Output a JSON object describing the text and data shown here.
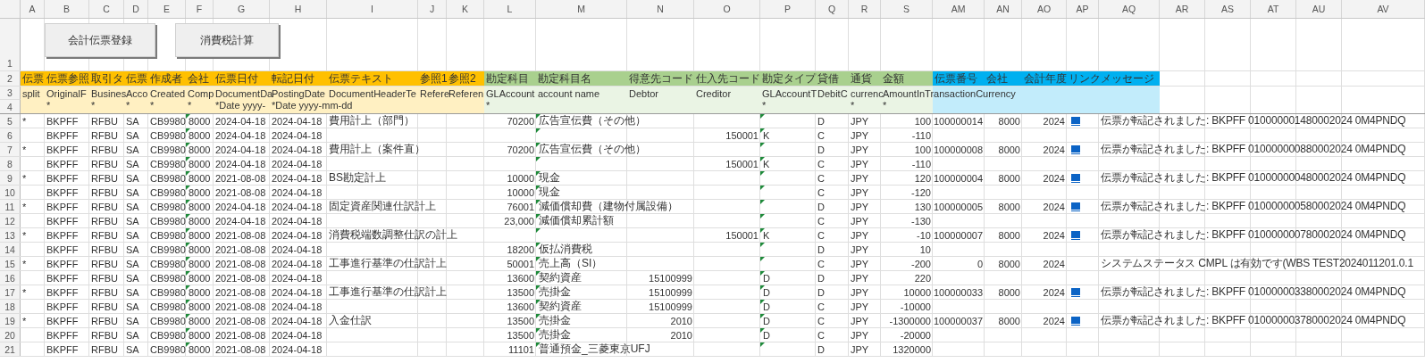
{
  "buttons": [
    {
      "label": "会計伝票登録"
    },
    {
      "label": "消費税計算"
    }
  ],
  "header_row_numbers": [
    "1",
    "2",
    "3",
    "4"
  ],
  "column_groups": [
    {
      "color": "#ffc000",
      "columns": [
        {
          "letter": "A",
          "kind": "text",
          "title": "伝票",
          "field": "split"
        },
        {
          "letter": "B",
          "kind": "text",
          "title": "伝票参照",
          "field": "OriginalF",
          "hint": "*"
        },
        {
          "letter": "C",
          "kind": "text",
          "title": "取引タ",
          "field": "Busines",
          "hint": "*"
        },
        {
          "letter": "D",
          "kind": "text",
          "title": "伝票",
          "field": "Acco",
          "hint": "*"
        },
        {
          "letter": "E",
          "kind": "text",
          "title": "作成者",
          "field": "Created",
          "hint": "*"
        },
        {
          "letter": "F",
          "kind": "flagged",
          "title": "会社",
          "field": "Comp",
          "hint": "*"
        },
        {
          "letter": "G",
          "kind": "text",
          "title": "伝票日付",
          "field": "DocumentDa",
          "hint": "*Date yyyy-"
        },
        {
          "letter": "H",
          "kind": "text",
          "title": "転記日付",
          "field": "PostingDate",
          "hint": "*Date yyyy-mm-dd"
        },
        {
          "letter": "I",
          "kind": "text",
          "title": "伝票テキスト",
          "field": "DocumentHeaderTe"
        },
        {
          "letter": "J",
          "kind": "text",
          "title": "参照1",
          "field": "Refere"
        },
        {
          "letter": "K",
          "kind": "text",
          "title": "参照2",
          "field": "Referen"
        }
      ]
    },
    {
      "color": "#a9d08e",
      "columns": [
        {
          "letter": "L",
          "kind": "number",
          "title": "勘定科目",
          "field": "GLAccount",
          "hint": "*"
        },
        {
          "letter": "M",
          "kind": "flagged",
          "title": "勘定科目名",
          "field": "account name"
        },
        {
          "letter": "N",
          "kind": "number",
          "title": "得意先コード",
          "field": "Debtor"
        },
        {
          "letter": "O",
          "kind": "number",
          "title": "仕入先コード",
          "field": "Creditor"
        },
        {
          "letter": "P",
          "kind": "flagged",
          "title": "勘定タイプ",
          "field": "GLAccountT",
          "hint": "*"
        },
        {
          "letter": "Q",
          "kind": "text",
          "title": "貸借",
          "field": "DebitC"
        },
        {
          "letter": "R",
          "kind": "text",
          "title": "通貨",
          "field": "currenc",
          "hint": "*"
        },
        {
          "letter": "S",
          "kind": "number",
          "title": "金額",
          "field": "AmountInTransactionCurrency",
          "hint": "*"
        }
      ]
    },
    {
      "color": "#00b0f0",
      "columns": [
        {
          "letter": "AM",
          "kind": "number",
          "title": "伝票番号"
        },
        {
          "letter": "AN",
          "kind": "number",
          "title": "会社"
        },
        {
          "letter": "AO",
          "kind": "number",
          "title": "会計年度"
        },
        {
          "letter": "AP",
          "kind": "link",
          "title": "リンク"
        },
        {
          "letter": "AQ",
          "kind": "text",
          "title": "メッセージ"
        }
      ]
    },
    {
      "columns": [
        {
          "letter": "AR",
          "kind": "text"
        },
        {
          "letter": "AS",
          "kind": "text"
        },
        {
          "letter": "AT",
          "kind": "text"
        },
        {
          "letter": "AU",
          "kind": "text"
        },
        {
          "letter": "AV",
          "kind": "text"
        }
      ]
    }
  ],
  "rows": [
    {
      "row": "5",
      "link": true,
      "cells": {
        "A": "*",
        "B": "BKPFF",
        "C": "RFBU",
        "D": "SA",
        "E": "CB9980",
        "F": "8000",
        "G": "2024-04-18",
        "H": "2024-04-18",
        "I": "費用計上（部門）",
        "L": "70200",
        "M": "広告宣伝費（その他）",
        "Q": "D",
        "R": "JPY",
        "S": "100",
        "AM": "100000014",
        "AN": "8000",
        "AO": "2024",
        "AQ": "伝票が転記されました: BKPFF 010000001480002024 0M4PNDQ"
      }
    },
    {
      "row": "6",
      "link": false,
      "cells": {
        "B": "BKPFF",
        "C": "RFBU",
        "D": "SA",
        "E": "CB9980",
        "F": "8000",
        "G": "2024-04-18",
        "H": "2024-04-18",
        "O": "150001",
        "P": "K",
        "Q": "C",
        "R": "JPY",
        "S": "-110"
      }
    },
    {
      "row": "7",
      "link": true,
      "cells": {
        "A": "*",
        "B": "BKPFF",
        "C": "RFBU",
        "D": "SA",
        "E": "CB9980",
        "F": "8000",
        "G": "2024-04-18",
        "H": "2024-04-18",
        "I": "費用計上（案件直）",
        "L": "70200",
        "M": "広告宣伝費（その他）",
        "Q": "D",
        "R": "JPY",
        "S": "100",
        "AM": "100000008",
        "AN": "8000",
        "AO": "2024",
        "AQ": "伝票が転記されました: BKPFF 010000000880002024 0M4PNDQ"
      }
    },
    {
      "row": "8",
      "link": false,
      "cells": {
        "B": "BKPFF",
        "C": "RFBU",
        "D": "SA",
        "E": "CB9980",
        "F": "8000",
        "G": "2024-04-18",
        "H": "2024-04-18",
        "O": "150001",
        "P": "K",
        "Q": "C",
        "R": "JPY",
        "S": "-110"
      }
    },
    {
      "row": "9",
      "link": true,
      "cells": {
        "A": "*",
        "B": "BKPFF",
        "C": "RFBU",
        "D": "SA",
        "E": "CB9980",
        "F": "8000",
        "G": "2021-08-08",
        "H": "2024-04-18",
        "I": "BS勘定計上",
        "L": "10000",
        "M": "現金",
        "Q": "C",
        "R": "JPY",
        "S": "120",
        "AM": "100000004",
        "AN": "8000",
        "AO": "2024",
        "AQ": "伝票が転記されました: BKPFF 010000000480002024 0M4PNDQ"
      }
    },
    {
      "row": "10",
      "link": false,
      "cells": {
        "B": "BKPFF",
        "C": "RFBU",
        "D": "SA",
        "E": "CB9980",
        "F": "8000",
        "G": "2021-08-08",
        "H": "2024-04-18",
        "L": "10000",
        "M": "現金",
        "Q": "C",
        "R": "JPY",
        "S": "-120"
      }
    },
    {
      "row": "11",
      "link": true,
      "cells": {
        "A": "*",
        "B": "BKPFF",
        "C": "RFBU",
        "D": "SA",
        "E": "CB9980",
        "F": "8000",
        "G": "2024-04-18",
        "H": "2024-04-18",
        "I": "固定資産関連仕訳計上",
        "L": "76001",
        "M": "減価償却費（建物付属設備）",
        "Q": "D",
        "R": "JPY",
        "S": "130",
        "AM": "100000005",
        "AN": "8000",
        "AO": "2024",
        "AQ": "伝票が転記されました: BKPFF 010000000580002024 0M4PNDQ"
      }
    },
    {
      "row": "12",
      "link": false,
      "cells": {
        "B": "BKPFF",
        "C": "RFBU",
        "D": "SA",
        "E": "CB9980",
        "F": "8000",
        "G": "2024-04-18",
        "H": "2024-04-18",
        "L": "23,000",
        "M": "減価償却累計額",
        "Q": "C",
        "R": "JPY",
        "S": "-130"
      }
    },
    {
      "row": "13",
      "link": true,
      "cells": {
        "A": "*",
        "B": "BKPFF",
        "C": "RFBU",
        "D": "SA",
        "E": "CB9980",
        "F": "8000",
        "G": "2021-08-08",
        "H": "2024-04-18",
        "I": "消費税端数調整仕訳の計上",
        "O": "150001",
        "P": "K",
        "Q": "C",
        "R": "JPY",
        "S": "-10",
        "AM": "100000007",
        "AN": "8000",
        "AO": "2024",
        "AQ": "伝票が転記されました: BKPFF 010000000780002024 0M4PNDQ"
      }
    },
    {
      "row": "14",
      "link": false,
      "cells": {
        "B": "BKPFF",
        "C": "RFBU",
        "D": "SA",
        "E": "CB9980",
        "F": "8000",
        "G": "2021-08-08",
        "H": "2024-04-18",
        "L": "18200",
        "M": "仮払消費税",
        "Q": "D",
        "R": "JPY",
        "S": "10"
      }
    },
    {
      "row": "15",
      "link": false,
      "cells": {
        "A": "*",
        "B": "BKPFF",
        "C": "RFBU",
        "D": "SA",
        "E": "CB9980",
        "F": "8000",
        "G": "2021-08-08",
        "H": "2024-04-18",
        "I": "工事進行基準の仕訳計上",
        "L": "50001",
        "M": "売上高（SI）",
        "Q": "C",
        "R": "JPY",
        "S": "-200",
        "AM": "0",
        "AN": "8000",
        "AO": "2024",
        "AQ": "システムステータス CMPL は有効です(WBS TEST2024011201.0.1"
      }
    },
    {
      "row": "16",
      "link": false,
      "cells": {
        "B": "BKPFF",
        "C": "RFBU",
        "D": "SA",
        "E": "CB9980",
        "F": "8000",
        "G": "2021-08-08",
        "H": "2024-04-18",
        "L": "13600",
        "M": "契約資産",
        "N": "15100999",
        "P": "D",
        "Q": "D",
        "R": "JPY",
        "S": "220"
      }
    },
    {
      "row": "17",
      "link": true,
      "cells": {
        "A": "*",
        "B": "BKPFF",
        "C": "RFBU",
        "D": "SA",
        "E": "CB9980",
        "F": "8000",
        "G": "2021-08-08",
        "H": "2024-04-18",
        "I": "工事進行基準の仕訳計上",
        "L": "13500",
        "M": "売掛金",
        "N": "15100999",
        "P": "D",
        "Q": "D",
        "R": "JPY",
        "S": "10000",
        "AM": "100000033",
        "AN": "8000",
        "AO": "2024",
        "AQ": "伝票が転記されました: BKPFF 010000003380002024 0M4PNDQ"
      }
    },
    {
      "row": "18",
      "link": false,
      "cells": {
        "B": "BKPFF",
        "C": "RFBU",
        "D": "SA",
        "E": "CB9980",
        "F": "8000",
        "G": "2021-08-08",
        "H": "2024-04-18",
        "L": "13600",
        "M": "契約資産",
        "N": "15100999",
        "P": "D",
        "Q": "C",
        "R": "JPY",
        "S": "-10000"
      }
    },
    {
      "row": "19",
      "link": true,
      "cells": {
        "A": "*",
        "B": "BKPFF",
        "C": "RFBU",
        "D": "SA",
        "E": "CB9980",
        "F": "8000",
        "G": "2021-08-08",
        "H": "2024-04-18",
        "I": "入金仕訳",
        "L": "13500",
        "M": "売掛金",
        "N": "2010",
        "P": "D",
        "Q": "C",
        "R": "JPY",
        "S": "-1300000",
        "AM": "100000037",
        "AN": "8000",
        "AO": "2024",
        "AQ": "伝票が転記されました: BKPFF 010000003780002024 0M4PNDQ"
      }
    },
    {
      "row": "20",
      "link": false,
      "cells": {
        "B": "BKPFF",
        "C": "RFBU",
        "D": "SA",
        "E": "CB9980",
        "F": "8000",
        "G": "2021-08-08",
        "H": "2024-04-18",
        "L": "13500",
        "M": "売掛金",
        "N": "2010",
        "P": "D",
        "Q": "C",
        "R": "JPY",
        "S": "-20000"
      }
    },
    {
      "row": "21",
      "link": false,
      "cells": {
        "B": "BKPFF",
        "C": "RFBU",
        "D": "SA",
        "E": "CB9980",
        "F": "8000",
        "G": "2021-08-08",
        "H": "2024-04-18",
        "L": "11101",
        "M": "普通預金_三菱東京UFJ",
        "Q": "D",
        "R": "JPY",
        "S": "1320000"
      }
    }
  ]
}
